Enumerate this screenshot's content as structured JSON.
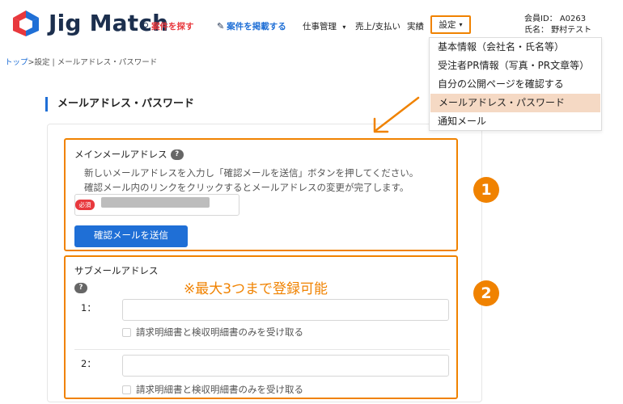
{
  "header": {
    "app_name": "Jig Match",
    "nav": {
      "find_jobs": "案件を探す",
      "post_job": "案件を掲載する",
      "job_management": "仕事管理",
      "sales_payments": "売上/支払い",
      "results": "実績",
      "settings": "設定"
    },
    "member_id": "会員ID： A0263",
    "member_name": "氏名： 野村テスト"
  },
  "dropdown": {
    "items": [
      "基本情報（会社名・氏名等）",
      "受注者PR情報（写真・PR文章等）",
      "自分の公開ページを確認する",
      "メールアドレス・パスワード",
      "通知メール"
    ]
  },
  "breadcrumb": {
    "top": "トップ",
    "rest": ">設定 | メールアドレス・パスワード"
  },
  "page_title": "メールアドレス・パスワード",
  "main_email": {
    "label": "メインメールアドレス",
    "help": "?",
    "desc1": "新しいメールアドレスを入力し「確認メールを送信」ボタンを押してください。",
    "desc2": "確認メール内のリンクをクリックするとメールアドレスの変更が完了します。",
    "required": "必須",
    "send_button": "確認メールを送信"
  },
  "sub_email": {
    "label": "サブメールアドレス",
    "help": "?",
    "annotation": "※最大3つまで登録可能",
    "rows": [
      {
        "num": "1：",
        "checkbox_label": "請求明細書と検収明細書のみを受け取る"
      },
      {
        "num": "2：",
        "checkbox_label": "請求明細書と検収明細書のみを受け取る"
      }
    ]
  },
  "callouts": {
    "one": "1",
    "two": "2"
  },
  "colors": {
    "accent_orange": "#f08200",
    "brand_blue": "#1f6fd6",
    "alert_red": "#e8383d"
  }
}
